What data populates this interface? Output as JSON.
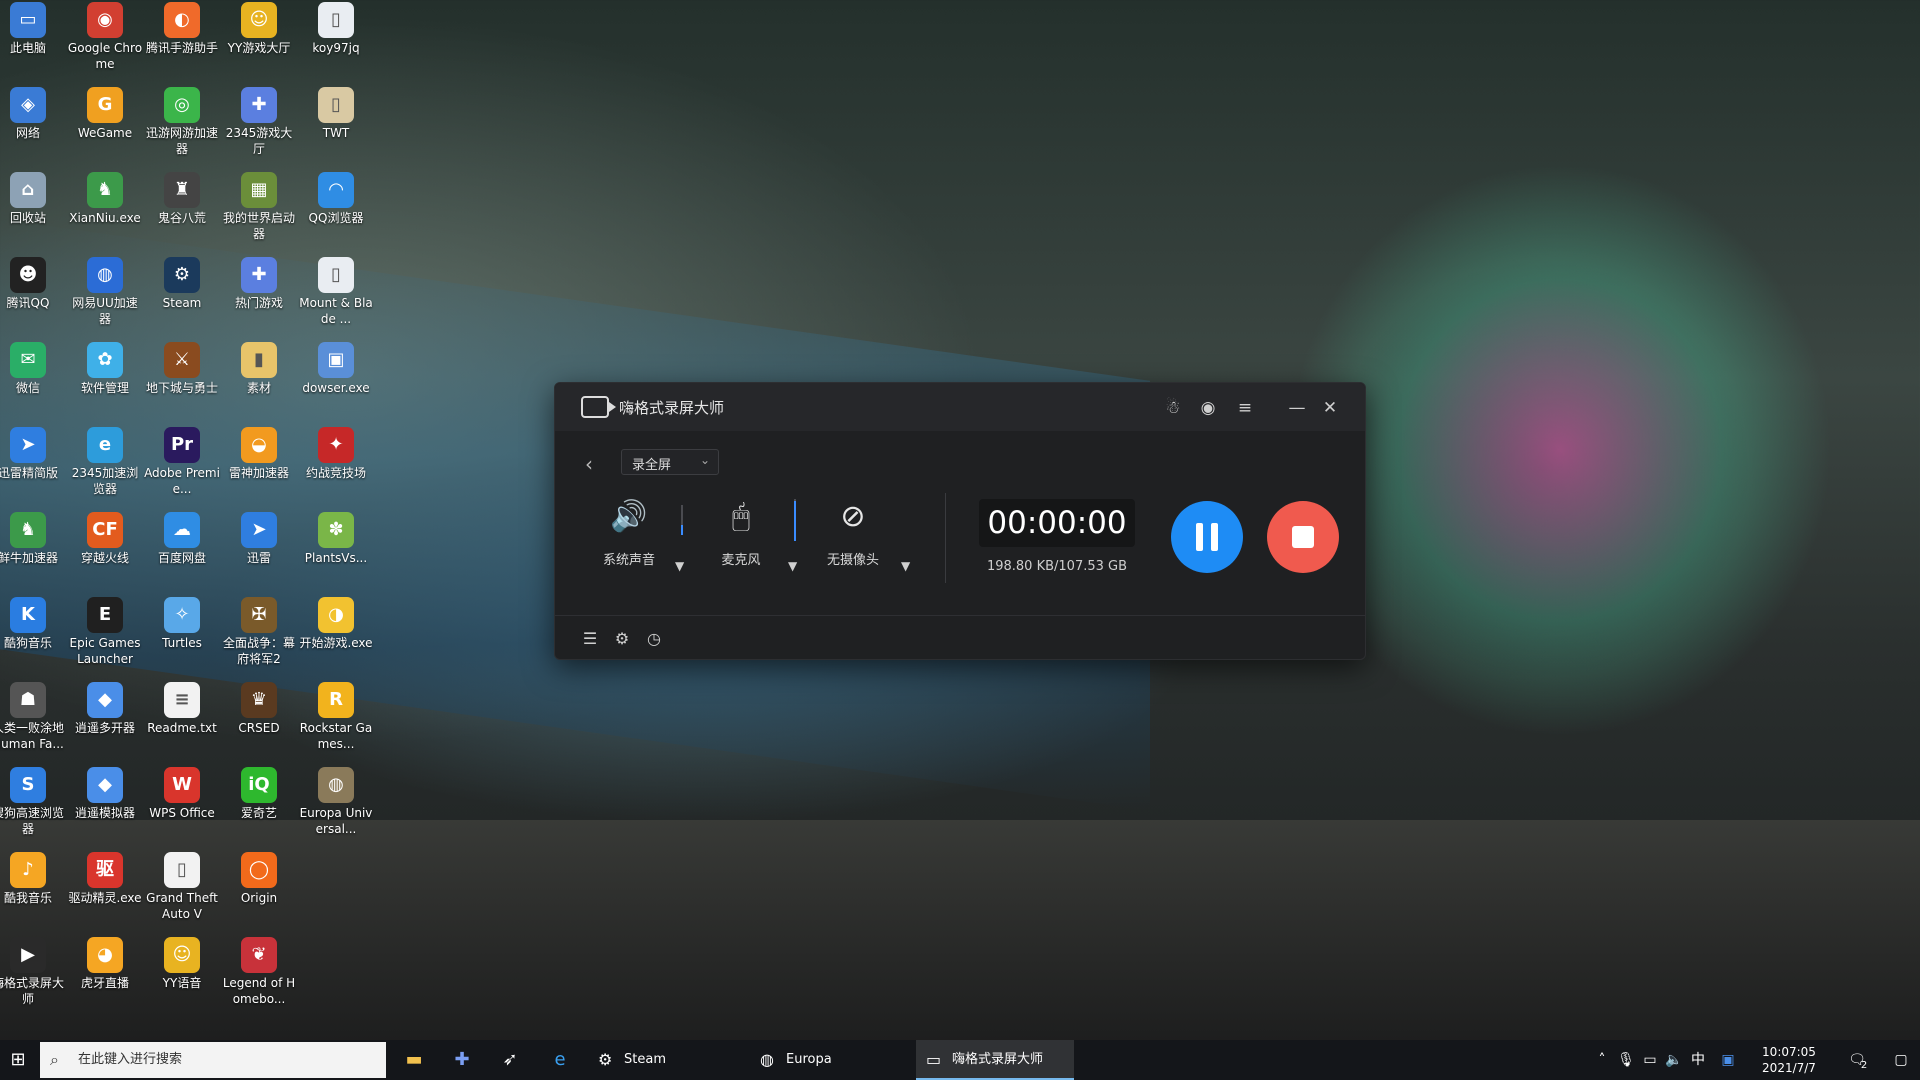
{
  "desktop_icons": [
    {
      "label": "此电脑",
      "icon": "pc-icon",
      "color": "#3a7bd5",
      "glyph": "▭"
    },
    {
      "label": "Google Chrome",
      "icon": "chrome-icon",
      "color": "#d23f31",
      "glyph": "◉"
    },
    {
      "label": "腾讯手游助手",
      "icon": "tencent-game-icon",
      "color": "#f06a2a",
      "glyph": "◐"
    },
    {
      "label": "YY游戏大厅",
      "icon": "yy-game-icon",
      "color": "#e8b321",
      "glyph": "☺"
    },
    {
      "label": "koy97jq",
      "icon": "file-icon",
      "color": "#e9edf2",
      "glyph": "▯"
    },
    {
      "label": "网络",
      "icon": "network-icon",
      "color": "#3a7bd5",
      "glyph": "◈"
    },
    {
      "label": "WeGame",
      "icon": "wegame-icon",
      "color": "#f0a020",
      "glyph": "G"
    },
    {
      "label": "迅游网游加速器",
      "icon": "xunyou-icon",
      "color": "#3bb54a",
      "glyph": "◎"
    },
    {
      "label": "2345游戏大厅",
      "icon": "gamepad-icon",
      "color": "#5b7fe0",
      "glyph": "✚"
    },
    {
      "label": "TWT",
      "icon": "file-icon",
      "color": "#d9c9a3",
      "glyph": "▯"
    },
    {
      "label": "回收站",
      "icon": "recycle-bin-icon",
      "color": "#8da2b5",
      "glyph": "⌂"
    },
    {
      "label": "XianNiu.exe",
      "icon": "xianniu-icon",
      "color": "#3c9a4a",
      "glyph": "♞"
    },
    {
      "label": "鬼谷八荒",
      "icon": "guigu-icon",
      "color": "#444444",
      "glyph": "♜"
    },
    {
      "label": "我的世界启动器",
      "icon": "minecraft-icon",
      "color": "#6b8e3a",
      "glyph": "▦"
    },
    {
      "label": "QQ浏览器",
      "icon": "qq-browser-icon",
      "color": "#2f8de4",
      "glyph": "◠"
    },
    {
      "label": "腾讯QQ",
      "icon": "qq-icon",
      "color": "#222222",
      "glyph": "☻"
    },
    {
      "label": "网易UU加速器",
      "icon": "uu-icon",
      "color": "#2b6cd6",
      "glyph": "◍"
    },
    {
      "label": "Steam",
      "icon": "steam-icon",
      "color": "#1b3a5c",
      "glyph": "⚙"
    },
    {
      "label": "热门游戏",
      "icon": "gamepad-icon",
      "color": "#5b7fe0",
      "glyph": "✚"
    },
    {
      "label": "Mount & Blade ...",
      "icon": "file-icon",
      "color": "#e9edf2",
      "glyph": "▯"
    },
    {
      "label": "微信",
      "icon": "wechat-icon",
      "color": "#2aae67",
      "glyph": "✉"
    },
    {
      "label": "软件管理",
      "icon": "software-manager-icon",
      "color": "#3fb0e8",
      "glyph": "✿"
    },
    {
      "label": "地下城与勇士",
      "icon": "dnf-icon",
      "color": "#8a4b1f",
      "glyph": "⚔"
    },
    {
      "label": "素材",
      "icon": "folder-icon",
      "color": "#e8c46a",
      "glyph": "▮"
    },
    {
      "label": "dowser.exe",
      "icon": "exe-icon",
      "color": "#5a8fd8",
      "glyph": "▣"
    },
    {
      "label": "迅雷精简版",
      "icon": "thunder-icon",
      "color": "#2f7ee0",
      "glyph": "➤"
    },
    {
      "label": "2345加速浏览器",
      "icon": "browser-icon",
      "color": "#2d9cdb",
      "glyph": "e"
    },
    {
      "label": "Adobe Premie...",
      "icon": "premiere-icon",
      "color": "#2a1a5e",
      "glyph": "Pr"
    },
    {
      "label": "雷神加速器",
      "icon": "leishen-icon",
      "color": "#f29a1f",
      "glyph": "◒"
    },
    {
      "label": "约战竞技场",
      "icon": "arena-icon",
      "color": "#c62828",
      "glyph": "✦"
    },
    {
      "label": "鲜牛加速器",
      "icon": "xianniu-icon",
      "color": "#3c9a4a",
      "glyph": "♞"
    },
    {
      "label": "穿越火线",
      "icon": "crossfire-icon",
      "color": "#e35b1e",
      "glyph": "CF"
    },
    {
      "label": "百度网盘",
      "icon": "baidu-pan-icon",
      "color": "#2f8de4",
      "glyph": "☁"
    },
    {
      "label": "迅雷",
      "icon": "thunder-icon",
      "color": "#2f7ee0",
      "glyph": "➤"
    },
    {
      "label": "PlantsVs...",
      "icon": "pvz-icon",
      "color": "#7ab648",
      "glyph": "✽"
    },
    {
      "label": "酷狗音乐",
      "icon": "kugou-icon",
      "color": "#2a7de1",
      "glyph": "K"
    },
    {
      "label": "Epic Games Launcher",
      "icon": "epic-icon",
      "color": "#202020",
      "glyph": "E"
    },
    {
      "label": "Turtles",
      "icon": "turtles-icon",
      "color": "#59a8e8",
      "glyph": "✧"
    },
    {
      "label": "全面战争：幕府将军2",
      "icon": "shogun-icon",
      "color": "#7a5a2a",
      "glyph": "✠"
    },
    {
      "label": "开始游戏.exe",
      "icon": "start-game-icon",
      "color": "#f2c230",
      "glyph": "◑"
    },
    {
      "label": "人类一败涂地 Human Fa...",
      "icon": "human-fall-icon",
      "color": "#555555",
      "glyph": "☗"
    },
    {
      "label": "逍遥多开器",
      "icon": "xiaoyao-multi-icon",
      "color": "#4a8ee8",
      "glyph": "◆"
    },
    {
      "label": "Readme.txt",
      "icon": "text-file-icon",
      "color": "#f2f2f2",
      "glyph": "≡"
    },
    {
      "label": "CRSED",
      "icon": "crsed-icon",
      "color": "#5a3a20",
      "glyph": "♛"
    },
    {
      "label": "Rockstar Games...",
      "icon": "rockstar-icon",
      "color": "#f2b31d",
      "glyph": "R"
    },
    {
      "label": "搜狗高速浏览器",
      "icon": "sogou-icon",
      "color": "#2f7ee0",
      "glyph": "S"
    },
    {
      "label": "逍遥模拟器",
      "icon": "xiaoyao-emulator-icon",
      "color": "#4a8ee8",
      "glyph": "◆"
    },
    {
      "label": "WPS Office",
      "icon": "wps-icon",
      "color": "#d9352c",
      "glyph": "W"
    },
    {
      "label": "爱奇艺",
      "icon": "iqiyi-icon",
      "color": "#2eb82e",
      "glyph": "iQ"
    },
    {
      "label": "Europa Universal...",
      "icon": "europa-icon",
      "color": "#8a7a5a",
      "glyph": "◍"
    },
    {
      "label": "酷我音乐",
      "icon": "kuwo-icon",
      "color": "#f5a623",
      "glyph": "♪"
    },
    {
      "label": "驱动精灵.exe",
      "icon": "driver-icon",
      "color": "#d9352c",
      "glyph": "驱"
    },
    {
      "label": "Grand Theft Auto V",
      "icon": "gta-icon",
      "color": "#f2f2f2",
      "glyph": "▯"
    },
    {
      "label": "Origin",
      "icon": "origin-icon",
      "color": "#f26a1b",
      "glyph": "◯"
    },
    {
      "label": "",
      "icon": "",
      "color": "",
      "glyph": ""
    },
    {
      "label": "嗨格式录屏大师",
      "icon": "recorder-icon",
      "color": "#2a2a2a",
      "glyph": "▶"
    },
    {
      "label": "虎牙直播",
      "icon": "huya-icon",
      "color": "#f5a623",
      "glyph": "◕"
    },
    {
      "label": "YY语音",
      "icon": "yy-voice-icon",
      "color": "#e8b321",
      "glyph": "☺"
    },
    {
      "label": "Legend of Homebo...",
      "icon": "legend-icon",
      "color": "#c8323a",
      "glyph": "❦"
    }
  ],
  "recorder": {
    "title": "嗨格式录屏大师",
    "mode": "录全屏",
    "controls": {
      "system_audio": "系统声音",
      "microphone": "麦克风",
      "camera": "无摄像头"
    },
    "volume": {
      "system_audio": 0.35,
      "microphone": 0.95
    },
    "timer": "00:00:00",
    "size": "198.80 KB/107.53 GB",
    "colors": {
      "pause": "#1e8cf5",
      "stop": "#f05a4e"
    }
  },
  "taskbar": {
    "search_placeholder": "在此键入进行搜索",
    "tasks": {
      "steam": "Steam",
      "europa": "Europa Universali...",
      "recorder": "嗨格式录屏大师"
    },
    "tray": {
      "ime": "中",
      "notifications": "2"
    },
    "clock": {
      "time": "10:07:05",
      "date": "2021/7/7"
    }
  }
}
